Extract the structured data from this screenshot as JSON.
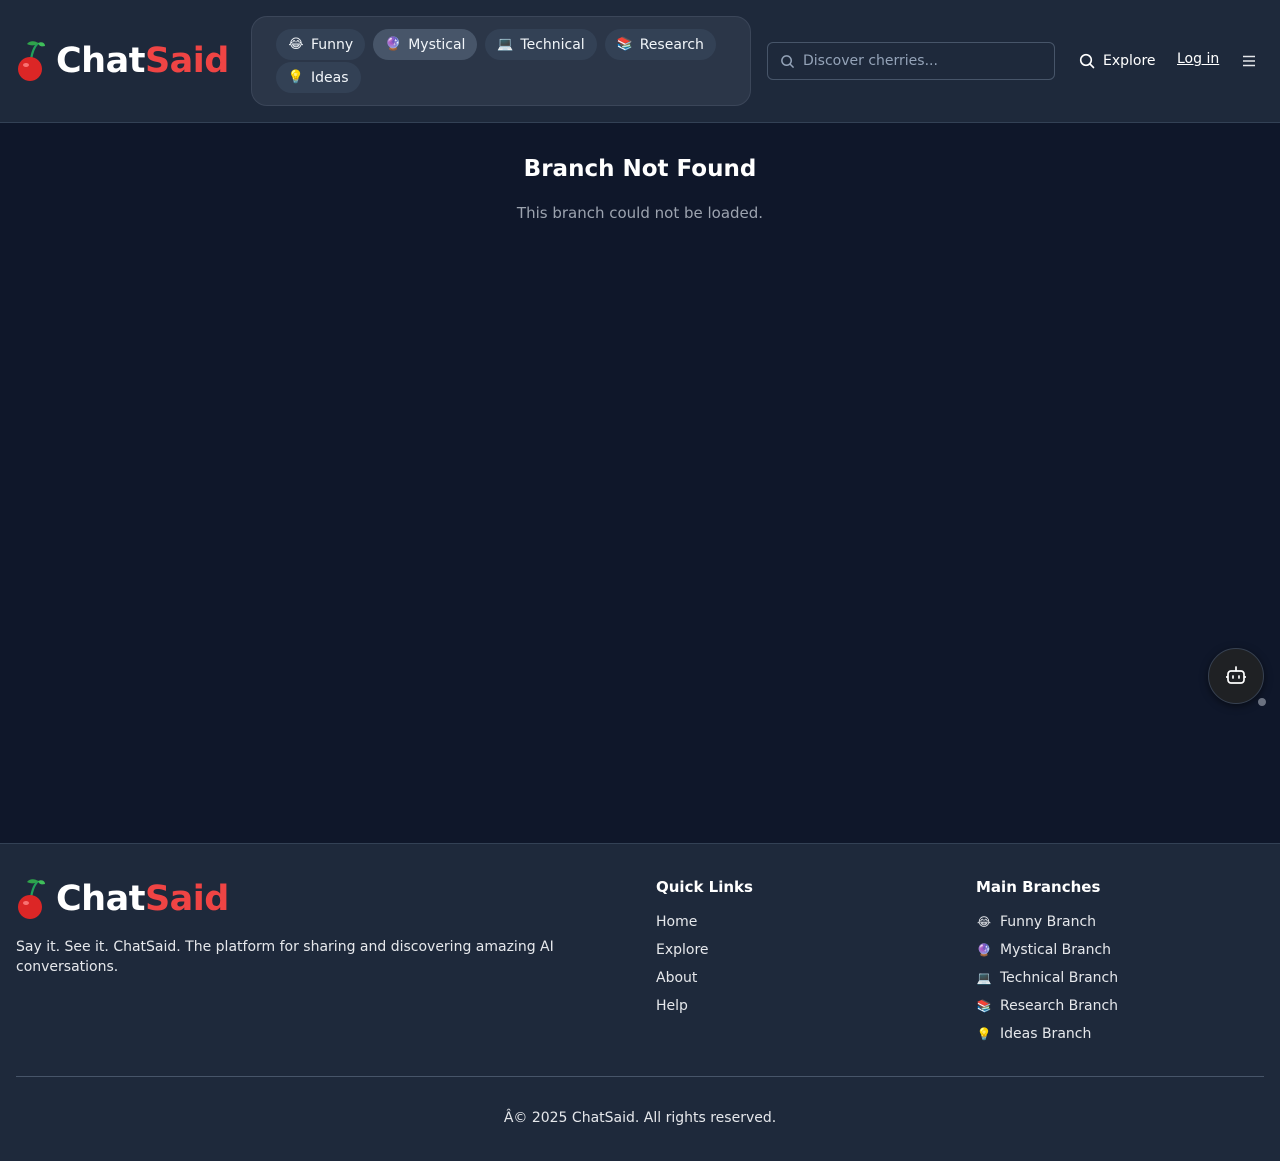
{
  "brand": {
    "name_part1": "Chat",
    "name_part2": "Said",
    "logo_icon": "cherry-icon",
    "accent": "#ef4444"
  },
  "header": {
    "branches": [
      {
        "label": "Funny",
        "icon": "laughing-face-icon",
        "emoji": "😂",
        "active": false
      },
      {
        "label": "Mystical",
        "icon": "crystal-ball-icon",
        "emoji": "🔮",
        "active": true
      },
      {
        "label": "Technical",
        "icon": "code-window-icon",
        "emoji": "💻",
        "active": false
      },
      {
        "label": "Research",
        "icon": "books-icon",
        "emoji": "📚",
        "active": false
      },
      {
        "label": "Ideas",
        "icon": "lightbulb-icon",
        "emoji": "💡",
        "active": false
      }
    ],
    "search_placeholder": "Discover cherries...",
    "explore_label": "Explore",
    "login_label": "Log in"
  },
  "main": {
    "title": "Branch Not Found",
    "subtitle": "This branch could not be loaded."
  },
  "footer": {
    "tagline": "Say it. See it. ChatSaid. The platform for sharing and discovering amazing AI conversations.",
    "quick_links_title": "Quick Links",
    "quick_links": [
      "Home",
      "Explore",
      "About",
      "Help"
    ],
    "branches_title": "Main Branches",
    "branch_links": [
      {
        "label": "Funny Branch",
        "emoji": "😂"
      },
      {
        "label": "Mystical Branch",
        "emoji": "🔮"
      },
      {
        "label": "Technical Branch",
        "emoji": "💻"
      },
      {
        "label": "Research Branch",
        "emoji": "📚"
      },
      {
        "label": "Ideas Branch",
        "emoji": "💡"
      }
    ],
    "copyright": "Â© 2025 ChatSaid. All rights reserved."
  }
}
